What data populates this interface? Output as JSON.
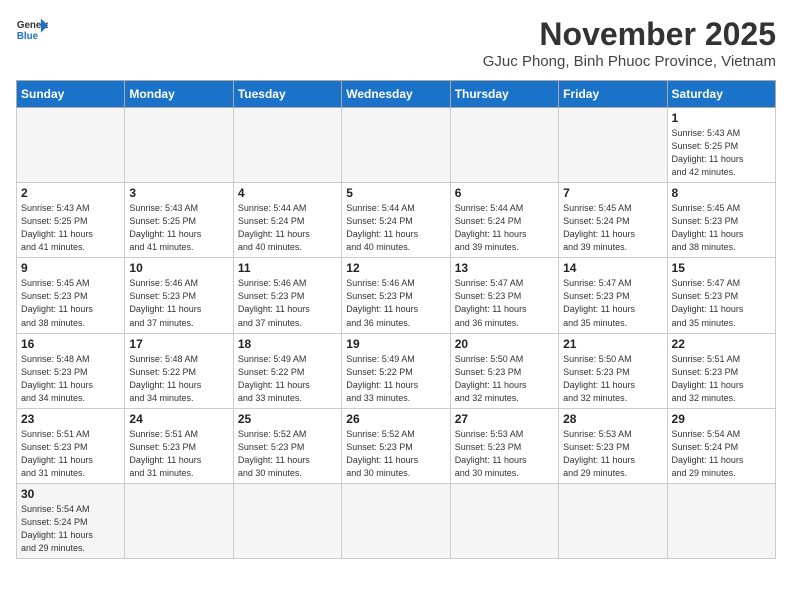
{
  "header": {
    "logo_general": "General",
    "logo_blue": "Blue",
    "month": "November 2025",
    "location": "GJuc Phong, Binh Phuoc Province, Vietnam"
  },
  "weekdays": [
    "Sunday",
    "Monday",
    "Tuesday",
    "Wednesday",
    "Thursday",
    "Friday",
    "Saturday"
  ],
  "weeks": [
    [
      {
        "day": "",
        "info": ""
      },
      {
        "day": "",
        "info": ""
      },
      {
        "day": "",
        "info": ""
      },
      {
        "day": "",
        "info": ""
      },
      {
        "day": "",
        "info": ""
      },
      {
        "day": "",
        "info": ""
      },
      {
        "day": "1",
        "info": "Sunrise: 5:43 AM\nSunset: 5:25 PM\nDaylight: 11 hours\nand 42 minutes."
      }
    ],
    [
      {
        "day": "2",
        "info": "Sunrise: 5:43 AM\nSunset: 5:25 PM\nDaylight: 11 hours\nand 41 minutes."
      },
      {
        "day": "3",
        "info": "Sunrise: 5:43 AM\nSunset: 5:25 PM\nDaylight: 11 hours\nand 41 minutes."
      },
      {
        "day": "4",
        "info": "Sunrise: 5:44 AM\nSunset: 5:24 PM\nDaylight: 11 hours\nand 40 minutes."
      },
      {
        "day": "5",
        "info": "Sunrise: 5:44 AM\nSunset: 5:24 PM\nDaylight: 11 hours\nand 40 minutes."
      },
      {
        "day": "6",
        "info": "Sunrise: 5:44 AM\nSunset: 5:24 PM\nDaylight: 11 hours\nand 39 minutes."
      },
      {
        "day": "7",
        "info": "Sunrise: 5:45 AM\nSunset: 5:24 PM\nDaylight: 11 hours\nand 39 minutes."
      },
      {
        "day": "8",
        "info": "Sunrise: 5:45 AM\nSunset: 5:23 PM\nDaylight: 11 hours\nand 38 minutes."
      }
    ],
    [
      {
        "day": "9",
        "info": "Sunrise: 5:45 AM\nSunset: 5:23 PM\nDaylight: 11 hours\nand 38 minutes."
      },
      {
        "day": "10",
        "info": "Sunrise: 5:46 AM\nSunset: 5:23 PM\nDaylight: 11 hours\nand 37 minutes."
      },
      {
        "day": "11",
        "info": "Sunrise: 5:46 AM\nSunset: 5:23 PM\nDaylight: 11 hours\nand 37 minutes."
      },
      {
        "day": "12",
        "info": "Sunrise: 5:46 AM\nSunset: 5:23 PM\nDaylight: 11 hours\nand 36 minutes."
      },
      {
        "day": "13",
        "info": "Sunrise: 5:47 AM\nSunset: 5:23 PM\nDaylight: 11 hours\nand 36 minutes."
      },
      {
        "day": "14",
        "info": "Sunrise: 5:47 AM\nSunset: 5:23 PM\nDaylight: 11 hours\nand 35 minutes."
      },
      {
        "day": "15",
        "info": "Sunrise: 5:47 AM\nSunset: 5:23 PM\nDaylight: 11 hours\nand 35 minutes."
      }
    ],
    [
      {
        "day": "16",
        "info": "Sunrise: 5:48 AM\nSunset: 5:23 PM\nDaylight: 11 hours\nand 34 minutes."
      },
      {
        "day": "17",
        "info": "Sunrise: 5:48 AM\nSunset: 5:22 PM\nDaylight: 11 hours\nand 34 minutes."
      },
      {
        "day": "18",
        "info": "Sunrise: 5:49 AM\nSunset: 5:22 PM\nDaylight: 11 hours\nand 33 minutes."
      },
      {
        "day": "19",
        "info": "Sunrise: 5:49 AM\nSunset: 5:22 PM\nDaylight: 11 hours\nand 33 minutes."
      },
      {
        "day": "20",
        "info": "Sunrise: 5:50 AM\nSunset: 5:23 PM\nDaylight: 11 hours\nand 32 minutes."
      },
      {
        "day": "21",
        "info": "Sunrise: 5:50 AM\nSunset: 5:23 PM\nDaylight: 11 hours\nand 32 minutes."
      },
      {
        "day": "22",
        "info": "Sunrise: 5:51 AM\nSunset: 5:23 PM\nDaylight: 11 hours\nand 32 minutes."
      }
    ],
    [
      {
        "day": "23",
        "info": "Sunrise: 5:51 AM\nSunset: 5:23 PM\nDaylight: 11 hours\nand 31 minutes."
      },
      {
        "day": "24",
        "info": "Sunrise: 5:51 AM\nSunset: 5:23 PM\nDaylight: 11 hours\nand 31 minutes."
      },
      {
        "day": "25",
        "info": "Sunrise: 5:52 AM\nSunset: 5:23 PM\nDaylight: 11 hours\nand 30 minutes."
      },
      {
        "day": "26",
        "info": "Sunrise: 5:52 AM\nSunset: 5:23 PM\nDaylight: 11 hours\nand 30 minutes."
      },
      {
        "day": "27",
        "info": "Sunrise: 5:53 AM\nSunset: 5:23 PM\nDaylight: 11 hours\nand 30 minutes."
      },
      {
        "day": "28",
        "info": "Sunrise: 5:53 AM\nSunset: 5:23 PM\nDaylight: 11 hours\nand 29 minutes."
      },
      {
        "day": "29",
        "info": "Sunrise: 5:54 AM\nSunset: 5:24 PM\nDaylight: 11 hours\nand 29 minutes."
      }
    ],
    [
      {
        "day": "30",
        "info": "Sunrise: 5:54 AM\nSunset: 5:24 PM\nDaylight: 11 hours\nand 29 minutes."
      },
      {
        "day": "",
        "info": ""
      },
      {
        "day": "",
        "info": ""
      },
      {
        "day": "",
        "info": ""
      },
      {
        "day": "",
        "info": ""
      },
      {
        "day": "",
        "info": ""
      },
      {
        "day": "",
        "info": ""
      }
    ]
  ]
}
